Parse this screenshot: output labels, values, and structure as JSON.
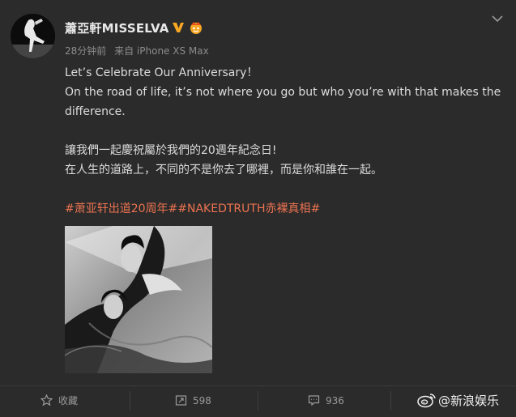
{
  "post": {
    "author": {
      "name": "蕭亞軒MISSELVA",
      "verified_badge_color": "#f5a623",
      "vip_badge_color": "#f5a623"
    },
    "meta": {
      "time": "28分钟前",
      "source": "来自 iPhone XS Max"
    },
    "content": {
      "line1": "Let’s Celebrate Our Anniversary！",
      "line2": "On the road of life, it’s not where you go but who you’re with that makes the difference.",
      "line3": "讓我們一起慶祝屬於我們的20週年紀念日!",
      "line4": "在人生的道路上，不同的不是你去了哪裡，而是你和誰在一起。",
      "hashtags": "#萧亚轩出道20周年##NAKEDTRUTH赤裸真相#"
    },
    "hashtag_color": "#eb7350",
    "image": {
      "description_icon": "photo-icon"
    }
  },
  "actions": {
    "favorite": {
      "label": "收藏",
      "icon": "star-icon"
    },
    "repost": {
      "count": "598",
      "icon": "repost-icon"
    },
    "comment": {
      "count": "936",
      "icon": "comment-icon"
    }
  },
  "watermark": {
    "text": "@新浪娱乐",
    "icon": "weibo-logo-icon"
  }
}
